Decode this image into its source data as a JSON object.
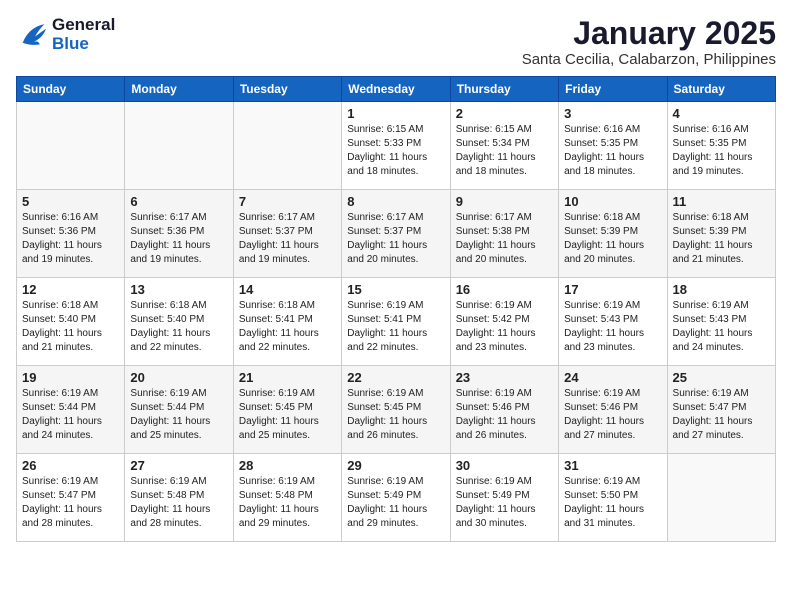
{
  "logo": {
    "line1": "General",
    "line2": "Blue"
  },
  "title": "January 2025",
  "subtitle": "Santa Cecilia, Calabarzon, Philippines",
  "days_header": [
    "Sunday",
    "Monday",
    "Tuesday",
    "Wednesday",
    "Thursday",
    "Friday",
    "Saturday"
  ],
  "weeks": [
    [
      {
        "day": "",
        "sunrise": "",
        "sunset": "",
        "daylight": ""
      },
      {
        "day": "",
        "sunrise": "",
        "sunset": "",
        "daylight": ""
      },
      {
        "day": "",
        "sunrise": "",
        "sunset": "",
        "daylight": ""
      },
      {
        "day": "1",
        "sunrise": "Sunrise: 6:15 AM",
        "sunset": "Sunset: 5:33 PM",
        "daylight": "Daylight: 11 hours and 18 minutes."
      },
      {
        "day": "2",
        "sunrise": "Sunrise: 6:15 AM",
        "sunset": "Sunset: 5:34 PM",
        "daylight": "Daylight: 11 hours and 18 minutes."
      },
      {
        "day": "3",
        "sunrise": "Sunrise: 6:16 AM",
        "sunset": "Sunset: 5:35 PM",
        "daylight": "Daylight: 11 hours and 18 minutes."
      },
      {
        "day": "4",
        "sunrise": "Sunrise: 6:16 AM",
        "sunset": "Sunset: 5:35 PM",
        "daylight": "Daylight: 11 hours and 19 minutes."
      }
    ],
    [
      {
        "day": "5",
        "sunrise": "Sunrise: 6:16 AM",
        "sunset": "Sunset: 5:36 PM",
        "daylight": "Daylight: 11 hours and 19 minutes."
      },
      {
        "day": "6",
        "sunrise": "Sunrise: 6:17 AM",
        "sunset": "Sunset: 5:36 PM",
        "daylight": "Daylight: 11 hours and 19 minutes."
      },
      {
        "day": "7",
        "sunrise": "Sunrise: 6:17 AM",
        "sunset": "Sunset: 5:37 PM",
        "daylight": "Daylight: 11 hours and 19 minutes."
      },
      {
        "day": "8",
        "sunrise": "Sunrise: 6:17 AM",
        "sunset": "Sunset: 5:37 PM",
        "daylight": "Daylight: 11 hours and 20 minutes."
      },
      {
        "day": "9",
        "sunrise": "Sunrise: 6:17 AM",
        "sunset": "Sunset: 5:38 PM",
        "daylight": "Daylight: 11 hours and 20 minutes."
      },
      {
        "day": "10",
        "sunrise": "Sunrise: 6:18 AM",
        "sunset": "Sunset: 5:39 PM",
        "daylight": "Daylight: 11 hours and 20 minutes."
      },
      {
        "day": "11",
        "sunrise": "Sunrise: 6:18 AM",
        "sunset": "Sunset: 5:39 PM",
        "daylight": "Daylight: 11 hours and 21 minutes."
      }
    ],
    [
      {
        "day": "12",
        "sunrise": "Sunrise: 6:18 AM",
        "sunset": "Sunset: 5:40 PM",
        "daylight": "Daylight: 11 hours and 21 minutes."
      },
      {
        "day": "13",
        "sunrise": "Sunrise: 6:18 AM",
        "sunset": "Sunset: 5:40 PM",
        "daylight": "Daylight: 11 hours and 22 minutes."
      },
      {
        "day": "14",
        "sunrise": "Sunrise: 6:18 AM",
        "sunset": "Sunset: 5:41 PM",
        "daylight": "Daylight: 11 hours and 22 minutes."
      },
      {
        "day": "15",
        "sunrise": "Sunrise: 6:19 AM",
        "sunset": "Sunset: 5:41 PM",
        "daylight": "Daylight: 11 hours and 22 minutes."
      },
      {
        "day": "16",
        "sunrise": "Sunrise: 6:19 AM",
        "sunset": "Sunset: 5:42 PM",
        "daylight": "Daylight: 11 hours and 23 minutes."
      },
      {
        "day": "17",
        "sunrise": "Sunrise: 6:19 AM",
        "sunset": "Sunset: 5:43 PM",
        "daylight": "Daylight: 11 hours and 23 minutes."
      },
      {
        "day": "18",
        "sunrise": "Sunrise: 6:19 AM",
        "sunset": "Sunset: 5:43 PM",
        "daylight": "Daylight: 11 hours and 24 minutes."
      }
    ],
    [
      {
        "day": "19",
        "sunrise": "Sunrise: 6:19 AM",
        "sunset": "Sunset: 5:44 PM",
        "daylight": "Daylight: 11 hours and 24 minutes."
      },
      {
        "day": "20",
        "sunrise": "Sunrise: 6:19 AM",
        "sunset": "Sunset: 5:44 PM",
        "daylight": "Daylight: 11 hours and 25 minutes."
      },
      {
        "day": "21",
        "sunrise": "Sunrise: 6:19 AM",
        "sunset": "Sunset: 5:45 PM",
        "daylight": "Daylight: 11 hours and 25 minutes."
      },
      {
        "day": "22",
        "sunrise": "Sunrise: 6:19 AM",
        "sunset": "Sunset: 5:45 PM",
        "daylight": "Daylight: 11 hours and 26 minutes."
      },
      {
        "day": "23",
        "sunrise": "Sunrise: 6:19 AM",
        "sunset": "Sunset: 5:46 PM",
        "daylight": "Daylight: 11 hours and 26 minutes."
      },
      {
        "day": "24",
        "sunrise": "Sunrise: 6:19 AM",
        "sunset": "Sunset: 5:46 PM",
        "daylight": "Daylight: 11 hours and 27 minutes."
      },
      {
        "day": "25",
        "sunrise": "Sunrise: 6:19 AM",
        "sunset": "Sunset: 5:47 PM",
        "daylight": "Daylight: 11 hours and 27 minutes."
      }
    ],
    [
      {
        "day": "26",
        "sunrise": "Sunrise: 6:19 AM",
        "sunset": "Sunset: 5:47 PM",
        "daylight": "Daylight: 11 hours and 28 minutes."
      },
      {
        "day": "27",
        "sunrise": "Sunrise: 6:19 AM",
        "sunset": "Sunset: 5:48 PM",
        "daylight": "Daylight: 11 hours and 28 minutes."
      },
      {
        "day": "28",
        "sunrise": "Sunrise: 6:19 AM",
        "sunset": "Sunset: 5:48 PM",
        "daylight": "Daylight: 11 hours and 29 minutes."
      },
      {
        "day": "29",
        "sunrise": "Sunrise: 6:19 AM",
        "sunset": "Sunset: 5:49 PM",
        "daylight": "Daylight: 11 hours and 29 minutes."
      },
      {
        "day": "30",
        "sunrise": "Sunrise: 6:19 AM",
        "sunset": "Sunset: 5:49 PM",
        "daylight": "Daylight: 11 hours and 30 minutes."
      },
      {
        "day": "31",
        "sunrise": "Sunrise: 6:19 AM",
        "sunset": "Sunset: 5:50 PM",
        "daylight": "Daylight: 11 hours and 31 minutes."
      },
      {
        "day": "",
        "sunrise": "",
        "sunset": "",
        "daylight": ""
      }
    ]
  ]
}
